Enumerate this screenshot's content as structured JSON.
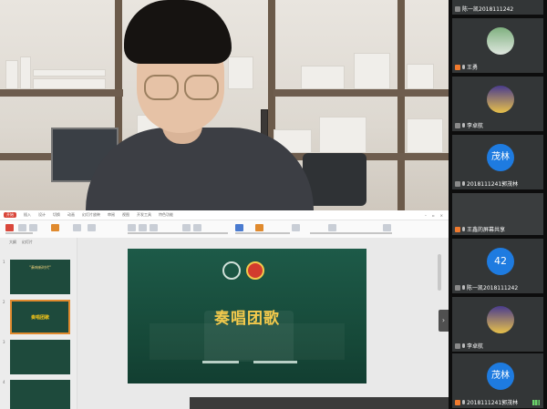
{
  "presentation": {
    "ribbon_tabs": [
      "开始",
      "插入",
      "设计",
      "切换",
      "动画",
      "幻灯片放映",
      "审阅",
      "视图",
      "开发工具",
      "特色功能"
    ],
    "active_tab": "开始",
    "panel_tabs": [
      "大纲",
      "幻灯片"
    ],
    "thumbnails": [
      {
        "number": "1",
        "text": "\"奏响新时代\""
      },
      {
        "number": "2",
        "text": "奏唱团歌"
      },
      {
        "number": "3",
        "text": ""
      },
      {
        "number": "4",
        "text": ""
      }
    ],
    "slide": {
      "title": "奏唱团歌"
    }
  },
  "participants": [
    {
      "name": "陈一凯2018111242",
      "avatar_text": "",
      "avatar_style": "none"
    },
    {
      "name": "王勇",
      "avatar_text": "",
      "avatar_style": "robot"
    },
    {
      "name": "李卓航",
      "avatar_text": "",
      "avatar_style": "game"
    },
    {
      "name": "2018111241郭茂林",
      "avatar_text": "茂林",
      "avatar_style": "blue"
    },
    {
      "name": "王鑫的屏幕共享",
      "avatar_text": "",
      "avatar_style": "none"
    },
    {
      "name": "陈一凯2018111242",
      "avatar_text": "42",
      "avatar_style": "blue"
    },
    {
      "name": "李卓航",
      "avatar_text": "",
      "avatar_style": "game"
    },
    {
      "name": "2018111241郭茂林",
      "avatar_text": "茂林",
      "avatar_style": "blue"
    }
  ],
  "colors": {
    "accent_red": "#d9473b",
    "slide_green": "#1d5a48",
    "title_gold": "#f2c94c",
    "avatar_blue": "#1e7be0",
    "badge_orange": "#f07a2e"
  }
}
